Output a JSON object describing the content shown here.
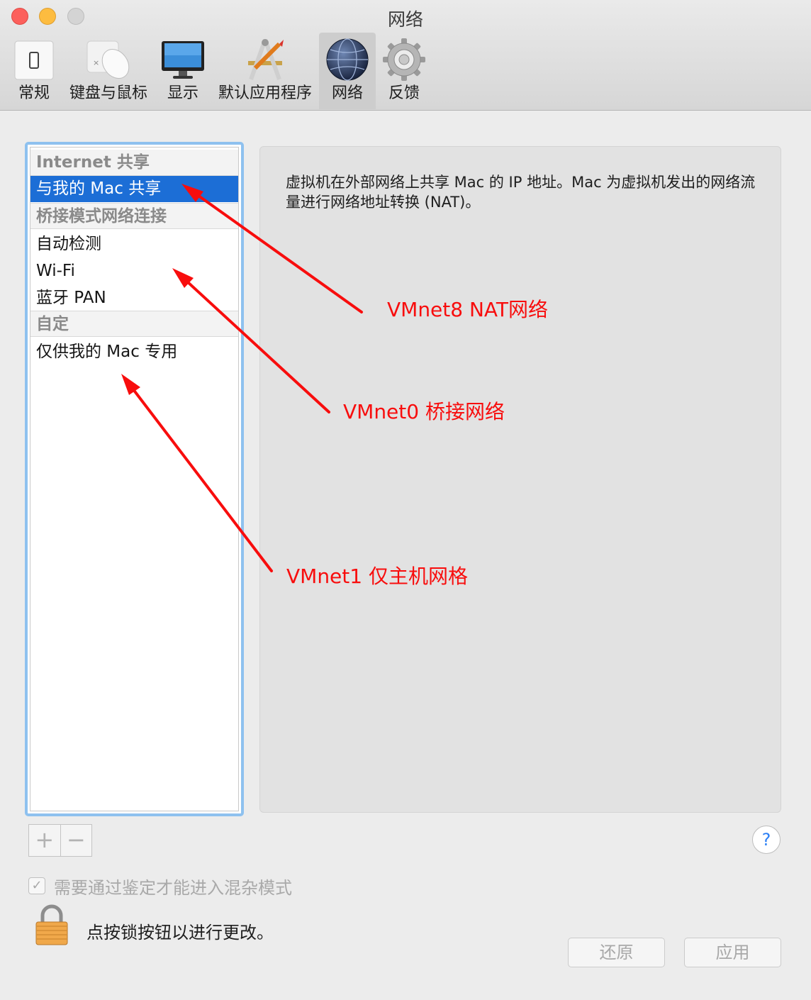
{
  "window": {
    "title": "网络"
  },
  "toolbar": {
    "items": [
      {
        "label": "常规",
        "icon": "general-switch-icon"
      },
      {
        "label": "键盘与鼠标",
        "icon": "keyboard-mouse-icon"
      },
      {
        "label": "显示",
        "icon": "display-icon"
      },
      {
        "label": "默认应用程序",
        "icon": "default-apps-icon"
      },
      {
        "label": "网络",
        "icon": "network-globe-icon",
        "selected": true
      },
      {
        "label": "反馈",
        "icon": "gear-icon"
      }
    ]
  },
  "network_list": {
    "groups": [
      {
        "header": "Internet 共享",
        "items": [
          "与我的 Mac 共享"
        ]
      },
      {
        "header": "桥接模式网络连接",
        "items": [
          "自动检测",
          "Wi-Fi",
          "蓝牙 PAN"
        ]
      },
      {
        "header": "自定",
        "items": [
          "仅供我的 Mac 专用"
        ]
      }
    ],
    "selected": "与我的 Mac 共享"
  },
  "detail": {
    "description": "虚拟机在外部网络上共享 Mac 的 IP 地址。Mac 为虚拟机发出的网络流量进行网络地址转换 (NAT)。"
  },
  "annotations": {
    "nat": "VMnet8 NAT网络",
    "bridge": "VMnet0 桥接网络",
    "hostonly": "VMnet1 仅主机网格"
  },
  "controls": {
    "add_label": "+",
    "remove_label": "−",
    "help_label": "?",
    "promiscuous_label": "需要通过鉴定才能进入混杂模式",
    "promiscuous_checked": true,
    "lock_text": "点按锁按钮以进行更改。",
    "revert_label": "还原",
    "apply_label": "应用"
  },
  "colors": {
    "selection": "#1c6ed6",
    "annotation": "#f80d0d",
    "focus_ring": "#8ec1ef"
  }
}
